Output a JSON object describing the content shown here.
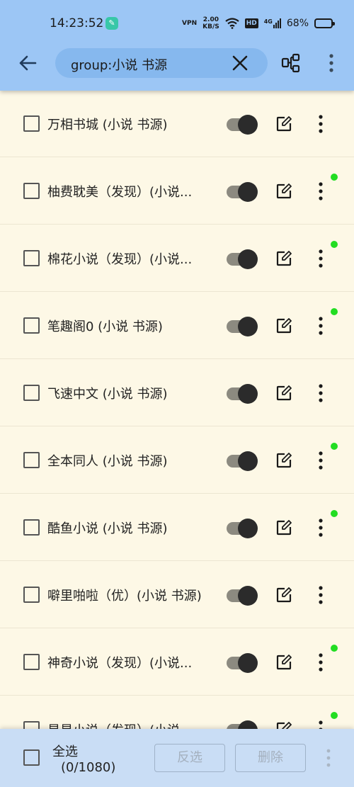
{
  "status_bar": {
    "time": "14:23:52",
    "notif_glyph": "✎",
    "vpn": "VPN",
    "speed_value": "2.00",
    "speed_unit": "KB/S",
    "hd": "HD",
    "net": "4G",
    "battery_pct": "68%",
    "battery_level": 0.68
  },
  "toolbar": {
    "search_query": "group:小说 书源",
    "icons": [
      "back-arrow-icon",
      "clear-icon",
      "group-icon",
      "more-vert-icon"
    ]
  },
  "list": {
    "items": [
      {
        "name": "万相书城 (小说 书源)",
        "enabled": true,
        "dot": false
      },
      {
        "name": "柚费耽美（发现）(小说...",
        "enabled": true,
        "dot": true
      },
      {
        "name": "棉花小说（发现）(小说...",
        "enabled": true,
        "dot": true
      },
      {
        "name": "笔趣阁0 (小说 书源)",
        "enabled": true,
        "dot": true
      },
      {
        "name": "飞速中文 (小说 书源)",
        "enabled": true,
        "dot": false
      },
      {
        "name": "全本同人 (小说 书源)",
        "enabled": true,
        "dot": true
      },
      {
        "name": "酷鱼小说 (小说 书源)",
        "enabled": true,
        "dot": true
      },
      {
        "name": "噼里啪啦（优）(小说 书源)",
        "enabled": true,
        "dot": false
      },
      {
        "name": "神奇小说（发现）(小说...",
        "enabled": true,
        "dot": true
      },
      {
        "name": "星星小说（发现）(小说...",
        "enabled": true,
        "dot": true
      }
    ]
  },
  "bottom": {
    "select_all_label": "全选",
    "count": "(0/1080)",
    "invert_label": "反选",
    "delete_label": "删除"
  },
  "colors": {
    "appbar": "#9cc6f5",
    "background": "#fdf8e6",
    "indicator": "#22dd22",
    "bottombar": "#c9ddf5"
  }
}
